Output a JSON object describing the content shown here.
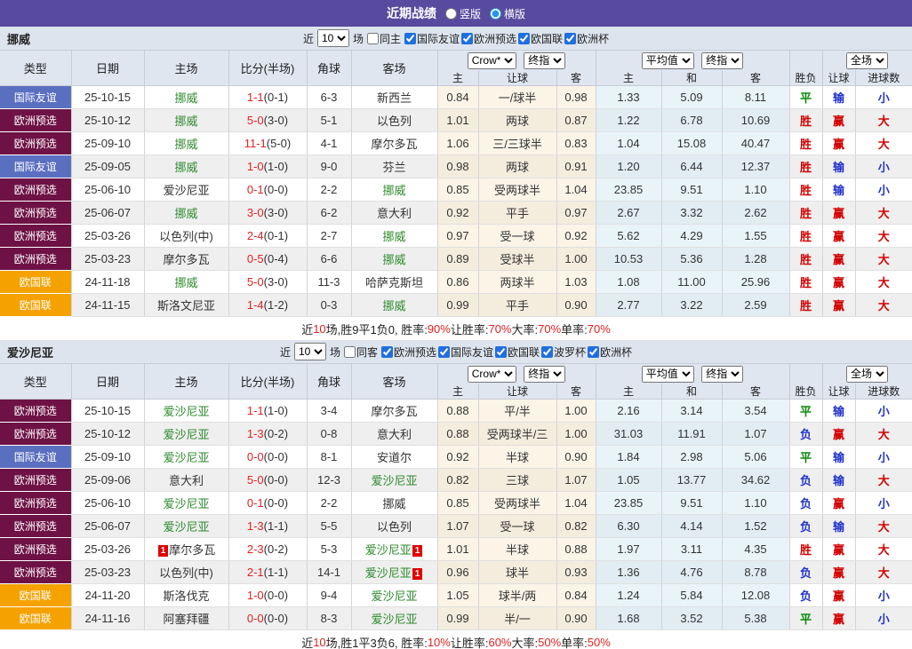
{
  "title_bar": {
    "title": "近期战绩",
    "radios": [
      {
        "label": "竖版",
        "selected": false
      },
      {
        "label": "横版",
        "selected": true
      }
    ]
  },
  "filter": {
    "near_label": "近",
    "count": "10",
    "games_label": "场"
  },
  "columns": {
    "type": "类型",
    "date": "日期",
    "home": "主场",
    "score": "比分(半场)",
    "corner": "角球",
    "away": "客场",
    "sub": {
      "c1": "主",
      "c2": "让球",
      "c3": "客",
      "c4": "主",
      "c5": "和",
      "c6": "客",
      "c7": "胜负",
      "c8": "让球",
      "c9": "进球数"
    },
    "dropdowns": {
      "crow": "Crow*",
      "final1": "终指",
      "avg": "平均值",
      "final2": "终指",
      "scope": "全场"
    }
  },
  "type_colors": {
    "国际友谊": "#5b6fc1",
    "欧洲预选": "#6e1245",
    "欧国联": "#f5a201"
  },
  "result_colors": {
    "胜": "#d40000",
    "平": "#0a8a0a",
    "负": "#2233cc",
    "赢": "#d40000",
    "输": "#2233cc",
    "大": "#d40000",
    "小": "#2233cc"
  },
  "tables": [
    {
      "team": "挪威",
      "same_label": "同主",
      "competitions": [
        "国际友谊",
        "欧洲预选",
        "欧国联",
        "欧洲杯"
      ],
      "rows": [
        {
          "type": "国际友谊",
          "date": "25-10-15",
          "home": "挪威",
          "home_green": true,
          "ft": "1-1",
          "ht": "(0-1)",
          "corner": "6-3",
          "away": "新西兰",
          "away_green": false,
          "o1": "0.84",
          "hcp": "一/球半",
          "o2": "0.98",
          "a1": "1.33",
          "a2": "5.09",
          "a3": "8.11",
          "res": "平",
          "hres": "输",
          "goals": "小"
        },
        {
          "type": "欧洲预选",
          "date": "25-10-12",
          "home": "挪威",
          "home_green": true,
          "ft": "5-0",
          "ht": "(3-0)",
          "corner": "5-1",
          "away": "以色列",
          "away_green": false,
          "o1": "1.01",
          "hcp": "两球",
          "o2": "0.87",
          "a1": "1.22",
          "a2": "6.78",
          "a3": "10.69",
          "res": "胜",
          "hres": "赢",
          "goals": "大"
        },
        {
          "type": "欧洲预选",
          "date": "25-09-10",
          "home": "挪威",
          "home_green": true,
          "ft": "11-1",
          "ht": "(5-0)",
          "corner": "4-1",
          "away": "摩尔多瓦",
          "away_green": false,
          "o1": "1.06",
          "hcp": "三/三球半",
          "o2": "0.83",
          "a1": "1.04",
          "a2": "15.08",
          "a3": "40.47",
          "res": "胜",
          "hres": "赢",
          "goals": "大"
        },
        {
          "type": "国际友谊",
          "date": "25-09-05",
          "home": "挪威",
          "home_green": true,
          "ft": "1-0",
          "ht": "(1-0)",
          "corner": "9-0",
          "away": "芬兰",
          "away_green": false,
          "o1": "0.98",
          "hcp": "两球",
          "o2": "0.91",
          "a1": "1.20",
          "a2": "6.44",
          "a3": "12.37",
          "res": "胜",
          "hres": "输",
          "goals": "小"
        },
        {
          "type": "欧洲预选",
          "date": "25-06-10",
          "home": "爱沙尼亚",
          "home_green": false,
          "ft": "0-1",
          "ht": "(0-0)",
          "corner": "2-2",
          "away": "挪威",
          "away_green": true,
          "o1": "0.85",
          "hcp": "受两球半",
          "o2": "1.04",
          "a1": "23.85",
          "a2": "9.51",
          "a3": "1.10",
          "res": "胜",
          "hres": "输",
          "goals": "小"
        },
        {
          "type": "欧洲预选",
          "date": "25-06-07",
          "home": "挪威",
          "home_green": true,
          "ft": "3-0",
          "ht": "(3-0)",
          "corner": "6-2",
          "away": "意大利",
          "away_green": false,
          "o1": "0.92",
          "hcp": "平手",
          "o2": "0.97",
          "a1": "2.67",
          "a2": "3.32",
          "a3": "2.62",
          "res": "胜",
          "hres": "赢",
          "goals": "大"
        },
        {
          "type": "欧洲预选",
          "date": "25-03-26",
          "home": "以色列(中)",
          "home_green": false,
          "ft": "2-4",
          "ht": "(0-1)",
          "corner": "2-7",
          "away": "挪威",
          "away_green": true,
          "o1": "0.97",
          "hcp": "受一球",
          "o2": "0.92",
          "a1": "5.62",
          "a2": "4.29",
          "a3": "1.55",
          "res": "胜",
          "hres": "赢",
          "goals": "大"
        },
        {
          "type": "欧洲预选",
          "date": "25-03-23",
          "home": "摩尔多瓦",
          "home_green": false,
          "ft": "0-5",
          "ht": "(0-4)",
          "corner": "6-6",
          "away": "挪威",
          "away_green": true,
          "o1": "0.89",
          "hcp": "受球半",
          "o2": "1.00",
          "a1": "10.53",
          "a2": "5.36",
          "a3": "1.28",
          "res": "胜",
          "hres": "赢",
          "goals": "大"
        },
        {
          "type": "欧国联",
          "date": "24-11-18",
          "home": "挪威",
          "home_green": true,
          "ft": "5-0",
          "ht": "(3-0)",
          "corner": "11-3",
          "away": "哈萨克斯坦",
          "away_green": false,
          "o1": "0.86",
          "hcp": "两球半",
          "o2": "1.03",
          "a1": "1.08",
          "a2": "11.00",
          "a3": "25.96",
          "res": "胜",
          "hres": "赢",
          "goals": "大"
        },
        {
          "type": "欧国联",
          "date": "24-11-15",
          "home": "斯洛文尼亚",
          "home_green": false,
          "ft": "1-4",
          "ht": "(1-2)",
          "corner": "0-3",
          "away": "挪威",
          "away_green": true,
          "o1": "0.99",
          "hcp": "平手",
          "o2": "0.90",
          "a1": "2.77",
          "a2": "3.22",
          "a3": "2.59",
          "res": "胜",
          "hres": "赢",
          "goals": "大"
        }
      ],
      "summary": {
        "parts": [
          {
            "t": "近",
            "red": false
          },
          {
            "t": "10",
            "red": true
          },
          {
            "t": "场,胜9平1负0, 胜率:",
            "red": false
          },
          {
            "t": "90%",
            "red": true
          },
          {
            "t": " 让胜率:",
            "red": false
          },
          {
            "t": "70%",
            "red": true
          },
          {
            "t": " 大率:",
            "red": false
          },
          {
            "t": "70%",
            "red": true
          },
          {
            "t": " 单率:",
            "red": false
          },
          {
            "t": "70%",
            "red": true
          }
        ]
      }
    },
    {
      "team": "爱沙尼亚",
      "same_label": "同客",
      "competitions": [
        "欧洲预选",
        "国际友谊",
        "欧国联",
        "波罗杯",
        "欧洲杯"
      ],
      "rows": [
        {
          "type": "欧洲预选",
          "date": "25-10-15",
          "home": "爱沙尼亚",
          "home_green": true,
          "ft": "1-1",
          "ht": "(1-0)",
          "corner": "3-4",
          "away": "摩尔多瓦",
          "away_green": false,
          "o1": "0.88",
          "hcp": "平/半",
          "o2": "1.00",
          "a1": "2.16",
          "a2": "3.14",
          "a3": "3.54",
          "res": "平",
          "hres": "输",
          "goals": "小"
        },
        {
          "type": "欧洲预选",
          "date": "25-10-12",
          "home": "爱沙尼亚",
          "home_green": true,
          "ft": "1-3",
          "ht": "(0-2)",
          "corner": "0-8",
          "away": "意大利",
          "away_green": false,
          "o1": "0.88",
          "hcp": "受两球半/三",
          "o2": "1.00",
          "a1": "31.03",
          "a2": "11.91",
          "a3": "1.07",
          "res": "负",
          "hres": "赢",
          "goals": "大"
        },
        {
          "type": "国际友谊",
          "date": "25-09-10",
          "home": "爱沙尼亚",
          "home_green": true,
          "ft": "0-0",
          "ht": "(0-0)",
          "corner": "8-1",
          "away": "安道尔",
          "away_green": false,
          "o1": "0.92",
          "hcp": "半球",
          "o2": "0.90",
          "a1": "1.84",
          "a2": "2.98",
          "a3": "5.06",
          "res": "平",
          "hres": "输",
          "goals": "小"
        },
        {
          "type": "欧洲预选",
          "date": "25-09-06",
          "home": "意大利",
          "home_green": false,
          "ft": "5-0",
          "ht": "(0-0)",
          "corner": "12-3",
          "away": "爱沙尼亚",
          "away_green": true,
          "o1": "0.82",
          "hcp": "三球",
          "o2": "1.07",
          "a1": "1.05",
          "a2": "13.77",
          "a3": "34.62",
          "res": "负",
          "hres": "输",
          "goals": "大"
        },
        {
          "type": "欧洲预选",
          "date": "25-06-10",
          "home": "爱沙尼亚",
          "home_green": true,
          "ft": "0-1",
          "ht": "(0-0)",
          "corner": "2-2",
          "away": "挪威",
          "away_green": false,
          "o1": "0.85",
          "hcp": "受两球半",
          "o2": "1.04",
          "a1": "23.85",
          "a2": "9.51",
          "a3": "1.10",
          "res": "负",
          "hres": "赢",
          "goals": "小"
        },
        {
          "type": "欧洲预选",
          "date": "25-06-07",
          "home": "爱沙尼亚",
          "home_green": true,
          "ft": "1-3",
          "ht": "(1-1)",
          "corner": "5-5",
          "away": "以色列",
          "away_green": false,
          "o1": "1.07",
          "hcp": "受一球",
          "o2": "0.82",
          "a1": "6.30",
          "a2": "4.14",
          "a3": "1.52",
          "res": "负",
          "hres": "输",
          "goals": "大"
        },
        {
          "type": "欧洲预选",
          "date": "25-03-26",
          "home": "摩尔多瓦",
          "home_green": false,
          "home_card": "1",
          "ft": "2-3",
          "ht": "(0-2)",
          "corner": "5-3",
          "away": "爱沙尼亚",
          "away_green": true,
          "away_card": "1",
          "o1": "1.01",
          "hcp": "半球",
          "o2": "0.88",
          "a1": "1.97",
          "a2": "3.11",
          "a3": "4.35",
          "res": "胜",
          "hres": "赢",
          "goals": "大"
        },
        {
          "type": "欧洲预选",
          "date": "25-03-23",
          "home": "以色列(中)",
          "home_green": false,
          "ft": "2-1",
          "ht": "(1-1)",
          "corner": "14-1",
          "away": "爱沙尼亚",
          "away_green": true,
          "away_card": "1",
          "o1": "0.96",
          "hcp": "球半",
          "o2": "0.93",
          "a1": "1.36",
          "a2": "4.76",
          "a3": "8.78",
          "res": "负",
          "hres": "赢",
          "goals": "大"
        },
        {
          "type": "欧国联",
          "date": "24-11-20",
          "home": "斯洛伐克",
          "home_green": false,
          "ft": "1-0",
          "ht": "(0-0)",
          "corner": "9-4",
          "away": "爱沙尼亚",
          "away_green": true,
          "o1": "1.05",
          "hcp": "球半/两",
          "o2": "0.84",
          "a1": "1.24",
          "a2": "5.84",
          "a3": "12.08",
          "res": "负",
          "hres": "赢",
          "goals": "小"
        },
        {
          "type": "欧国联",
          "date": "24-11-16",
          "home": "阿塞拜疆",
          "home_green": false,
          "ft": "0-0",
          "ht": "(0-0)",
          "corner": "8-3",
          "away": "爱沙尼亚",
          "away_green": true,
          "o1": "0.99",
          "hcp": "半/一",
          "o2": "0.90",
          "a1": "1.68",
          "a2": "3.52",
          "a3": "5.38",
          "res": "平",
          "hres": "赢",
          "goals": "小"
        }
      ],
      "summary": {
        "parts": [
          {
            "t": "近",
            "red": false
          },
          {
            "t": "10",
            "red": true
          },
          {
            "t": "场,胜1平3负6, 胜率:",
            "red": false
          },
          {
            "t": "10%",
            "red": true
          },
          {
            "t": " 让胜率:",
            "red": false
          },
          {
            "t": "60%",
            "red": true
          },
          {
            "t": " 大率:",
            "red": false
          },
          {
            "t": "50%",
            "red": true
          },
          {
            "t": " 单率:",
            "red": false
          },
          {
            "t": "50%",
            "red": true
          }
        ]
      }
    }
  ]
}
